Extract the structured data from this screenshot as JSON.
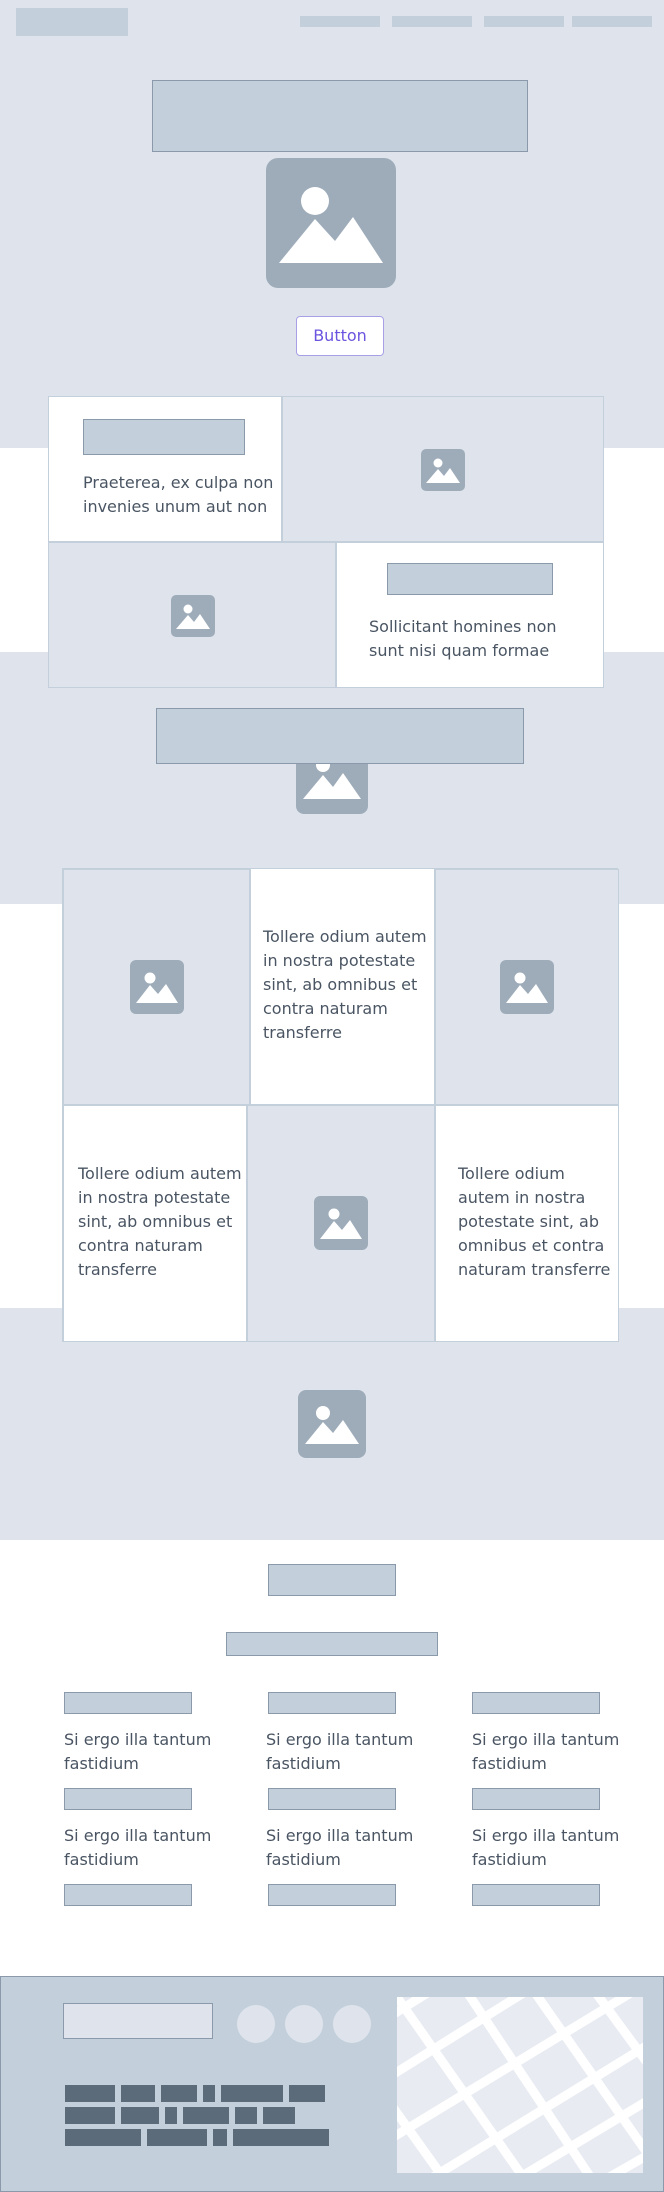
{
  "hero": {
    "button_label": "Button"
  },
  "feature_grid": {
    "card1_text": "Praeterea, ex culpa non invenies unum aut non",
    "card2_text": "Sollicitant homines non sunt nisi quam formae"
  },
  "gallery_grid": {
    "text_a": "Tollere odium autem in nostra potestate sint, ab omnibus et contra naturam transferre",
    "text_b": "Tollere odium autem in nostra potestate sint, ab omnibus et contra naturam transferre",
    "text_c": "Tollere odium autem in nostra potestate sint, ab omnibus et contra naturam transferre"
  },
  "list_section": {
    "items": [
      "Si ergo illa tantum fastidium",
      "Si ergo illa tantum fastidium",
      "Si ergo illa tantum fastidium",
      "Si ergo illa tantum fastidium",
      "Si ergo illa tantum fastidium",
      "Si ergo illa tantum fastidium"
    ]
  },
  "colors": {
    "band": "#dfe4ec",
    "placeholder": "#c3cfda",
    "image": "#9eacba",
    "accent": "#6b55e0",
    "footer": "#c3cfda"
  }
}
